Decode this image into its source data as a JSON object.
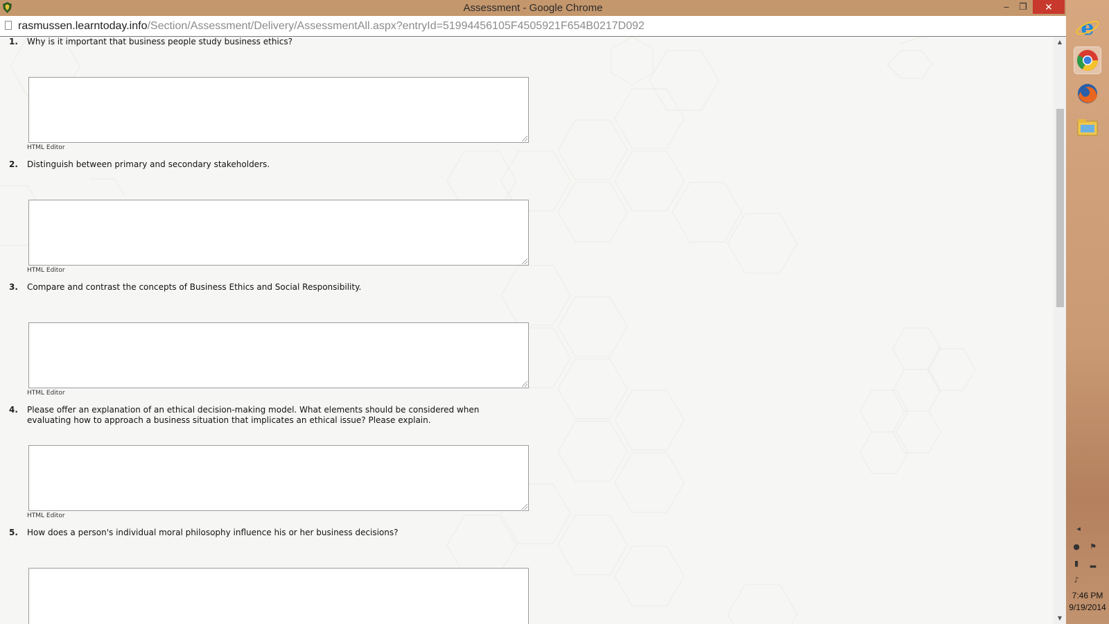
{
  "window": {
    "title": "Assessment - Google Chrome",
    "controls": {
      "minimize": "–",
      "maximize": "❐",
      "close": "✕"
    }
  },
  "address": {
    "host": "rasmussen.learntoday.info",
    "path": "/Section/Assessment/Delivery/AssessmentAll.aspx?entryId=51994456105F4505921F654B0217D092"
  },
  "questions": [
    {
      "number": "1.",
      "text": "Why is it important that business people study business ethics?",
      "editor_label": "HTML Editor"
    },
    {
      "number": "2.",
      "text": "Distinguish between primary and secondary stakeholders.",
      "editor_label": "HTML Editor"
    },
    {
      "number": "3.",
      "text": "Compare and contrast the concepts of Business Ethics and Social Responsibility.",
      "editor_label": "HTML Editor"
    },
    {
      "number": "4.",
      "text": "Please offer an explanation of an ethical decision-making model. What elements should be considered when evaluating how to approach a business situation that implicates an ethical issue? Please explain.",
      "editor_label": "HTML Editor"
    },
    {
      "number": "5.",
      "text": "How does a person's individual moral philosophy influence his or her business decisions?",
      "editor_label": ""
    }
  ],
  "taskbar": {
    "icons": [
      "internet-explorer-icon",
      "chrome-icon",
      "firefox-icon",
      "file-explorer-icon"
    ],
    "clock": {
      "time": "7:46 PM",
      "date": "9/19/2014"
    }
  },
  "colors": {
    "titlebar": "#c5976d",
    "close": "#c7392c",
    "page_bg": "#f6f6f5"
  }
}
